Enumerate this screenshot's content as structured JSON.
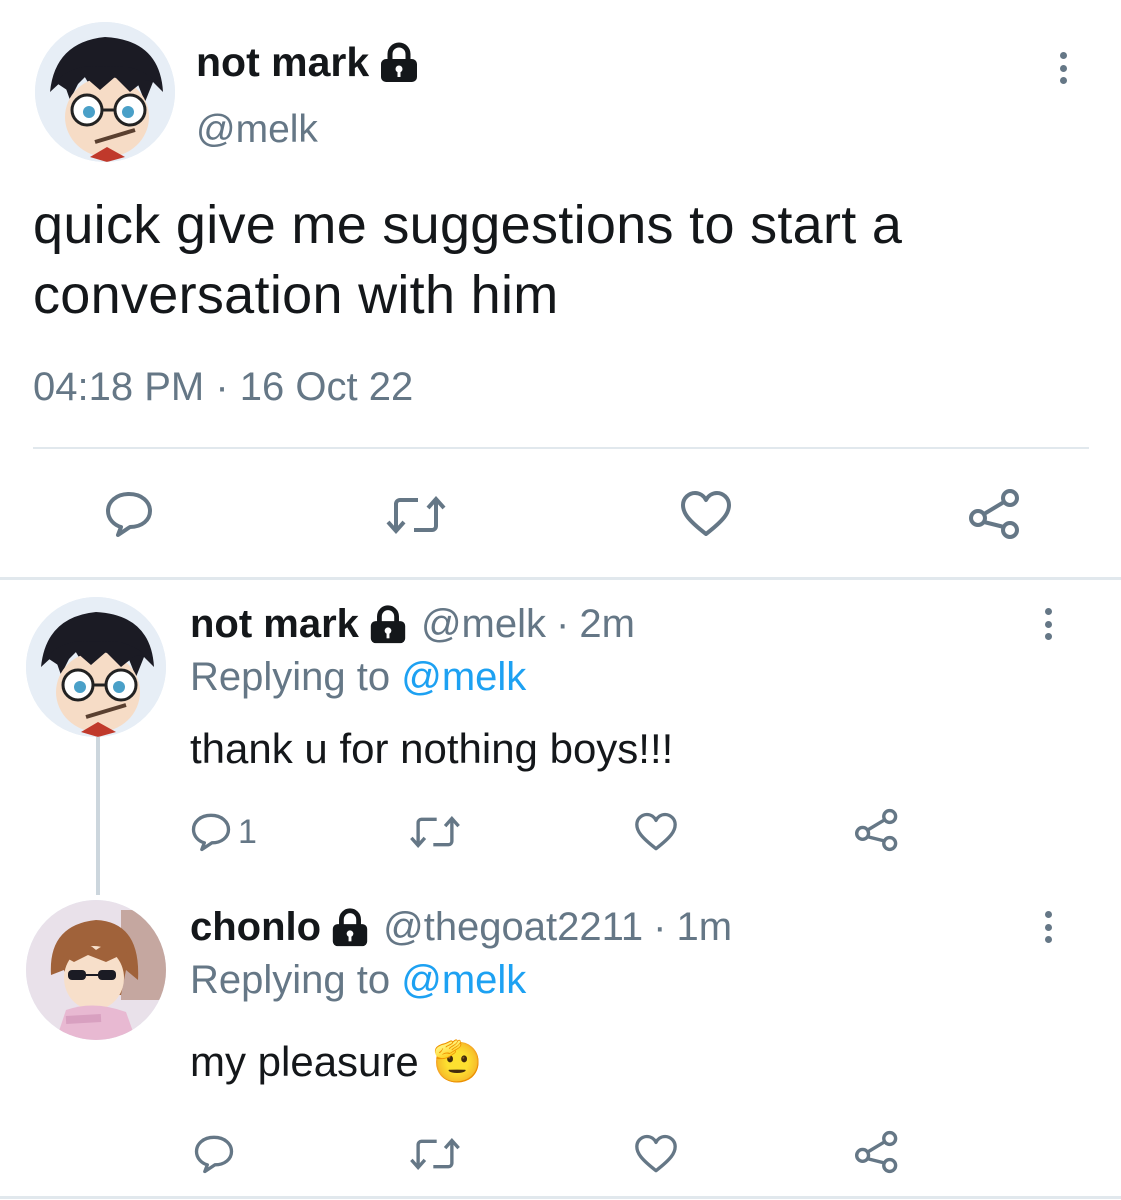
{
  "main_tweet": {
    "display_name": "not mark",
    "handle": "@melk",
    "text_line1": "quick give me suggestions to start a",
    "text_line2": "conversation with him",
    "time": "04:18 PM",
    "separator": "·",
    "date": "16 Oct 22"
  },
  "replies": [
    {
      "display_name": "not mark",
      "handle": "@melk",
      "separator": "·",
      "age": "2m",
      "replying_label": "Replying to",
      "replying_handle": "@melk",
      "text": "thank u for nothing boys!!!",
      "reply_count": "1"
    },
    {
      "display_name": "chonlo",
      "handle": "@thegoat2211",
      "separator": "·",
      "age": "1m",
      "replying_label": "Replying to",
      "replying_handle": "@melk",
      "text": "my pleasure",
      "emoji": "🫡"
    }
  ],
  "icons": {
    "lock": "lock-icon",
    "more": "more-vertical-icon",
    "reply": "reply-icon",
    "retweet": "retweet-icon",
    "like": "heart-icon",
    "share": "share-icon"
  },
  "colors": {
    "text": "#14171a",
    "muted": "#657786",
    "link": "#1da1f2",
    "divider": "#e1e8ed"
  }
}
